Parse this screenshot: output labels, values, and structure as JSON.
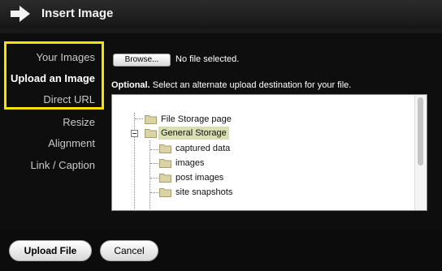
{
  "dialog": {
    "title": "Insert Image"
  },
  "nav": {
    "items": [
      {
        "label": "Your Images"
      },
      {
        "label": "Upload an Image"
      },
      {
        "label": "Direct URL"
      },
      {
        "label": "Resize"
      },
      {
        "label": "Alignment"
      },
      {
        "label": "Link / Caption"
      }
    ],
    "active": "Upload an Image"
  },
  "upload": {
    "browse_label": "Browse...",
    "file_status": "No file selected.",
    "optional_bold": "Optional.",
    "optional_text": " Select an alternate upload destination for your file."
  },
  "tree": {
    "items": [
      {
        "label": "File Storage page"
      },
      {
        "label": "General Storage",
        "selected": true
      },
      {
        "label": "captured data"
      },
      {
        "label": "images"
      },
      {
        "label": "post images"
      },
      {
        "label": "site snapshots"
      }
    ]
  },
  "footer": {
    "upload_label": "Upload File",
    "cancel_label": "Cancel"
  },
  "colors": {
    "highlight": "#f5e400",
    "selected_row": "#d9dfb3",
    "folder": "#d9d3a6"
  },
  "icons": {
    "title": "arrow-right-icon",
    "tree_folder": "folder-icon",
    "tree_toggle": "collapse-minus-icon"
  }
}
